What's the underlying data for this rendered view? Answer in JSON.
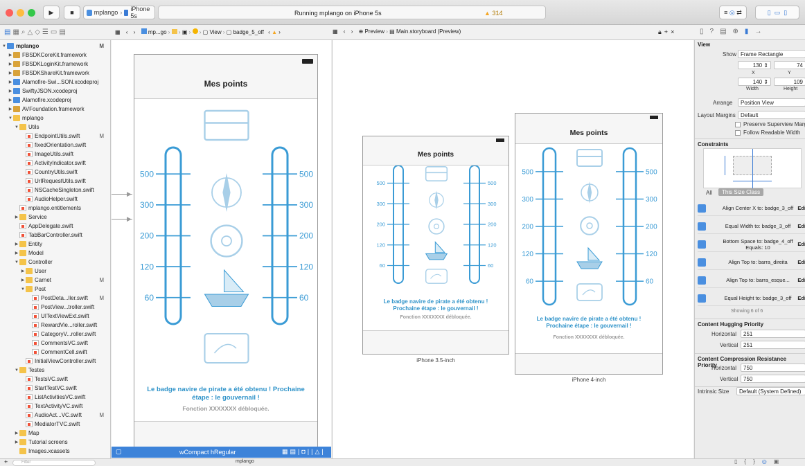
{
  "toolbar": {
    "scheme": "mplango",
    "device": "iPhone 5s",
    "status": "Running mplango on iPhone 5s",
    "warnings": "314"
  },
  "jumpbar": {
    "left_crumbs": [
      "mp...go",
      "View",
      "badge_5_off"
    ],
    "right_crumbs": [
      "Preview",
      "Main.storyboard (Preview)"
    ]
  },
  "navigator": {
    "items": [
      {
        "label": "mplango",
        "icon": "project",
        "level": 0,
        "open": true,
        "badge": "M"
      },
      {
        "label": "FBSDKCoreKit.framework",
        "icon": "framework",
        "level": 1,
        "open": false,
        "badge": ""
      },
      {
        "label": "FBSDKLoginKit.framework",
        "icon": "framework",
        "level": 1,
        "open": false,
        "badge": ""
      },
      {
        "label": "FBSDKShareKit.framework",
        "icon": "framework",
        "level": 1,
        "open": false,
        "badge": ""
      },
      {
        "label": "Alamofire-Swi...SON.xcodeproj",
        "icon": "project",
        "level": 1,
        "open": false,
        "badge": ""
      },
      {
        "label": "SwiftyJSON.xcodeproj",
        "icon": "project",
        "level": 1,
        "open": false,
        "badge": ""
      },
      {
        "label": "Alamofire.xcodeproj",
        "icon": "project",
        "level": 1,
        "open": false,
        "badge": ""
      },
      {
        "label": "AVFoundation.framework",
        "icon": "framework",
        "level": 1,
        "open": false,
        "badge": ""
      },
      {
        "label": "mplango",
        "icon": "folder",
        "level": 1,
        "open": true,
        "badge": ""
      },
      {
        "label": "Utils",
        "icon": "folder",
        "level": 2,
        "open": true,
        "badge": ""
      },
      {
        "label": "EndpointUtils.swift",
        "icon": "swift",
        "level": 3,
        "open": null,
        "badge": "M"
      },
      {
        "label": "fixedOrientation.swift",
        "icon": "swift",
        "level": 3,
        "open": null,
        "badge": ""
      },
      {
        "label": "ImageUtils.swift",
        "icon": "swift",
        "level": 3,
        "open": null,
        "badge": ""
      },
      {
        "label": "ActivityIndicator.swift",
        "icon": "swift",
        "level": 3,
        "open": null,
        "badge": ""
      },
      {
        "label": "CountryUtils.swift",
        "icon": "swift",
        "level": 3,
        "open": null,
        "badge": ""
      },
      {
        "label": "UrlRequestUtils.swift",
        "icon": "swift",
        "level": 3,
        "open": null,
        "badge": ""
      },
      {
        "label": "NSCacheSingleton.swift",
        "icon": "swift",
        "level": 3,
        "open": null,
        "badge": ""
      },
      {
        "label": "AudioHelper.swift",
        "icon": "swift",
        "level": 3,
        "open": null,
        "badge": ""
      },
      {
        "label": "mplango.entitlements",
        "icon": "file",
        "level": 2,
        "open": null,
        "badge": ""
      },
      {
        "label": "Service",
        "icon": "folder",
        "level": 2,
        "open": false,
        "badge": ""
      },
      {
        "label": "AppDelegate.swift",
        "icon": "swift",
        "level": 2,
        "open": null,
        "badge": ""
      },
      {
        "label": "TabBarController.swift",
        "icon": "swift",
        "level": 2,
        "open": null,
        "badge": ""
      },
      {
        "label": "Entity",
        "icon": "folder",
        "level": 2,
        "open": false,
        "badge": ""
      },
      {
        "label": "Model",
        "icon": "folder",
        "level": 2,
        "open": false,
        "badge": ""
      },
      {
        "label": "Controller",
        "icon": "folder",
        "level": 2,
        "open": true,
        "badge": ""
      },
      {
        "label": "User",
        "icon": "folder",
        "level": 3,
        "open": false,
        "badge": ""
      },
      {
        "label": "Carnet",
        "icon": "folder",
        "level": 3,
        "open": false,
        "badge": "M"
      },
      {
        "label": "Post",
        "icon": "folder",
        "level": 3,
        "open": true,
        "badge": ""
      },
      {
        "label": "PostDeta...ller.swift",
        "icon": "swift",
        "level": 4,
        "open": null,
        "badge": "M"
      },
      {
        "label": "PostView...troller.swift",
        "icon": "swift",
        "level": 4,
        "open": null,
        "badge": ""
      },
      {
        "label": "UITextViewExt.swift",
        "icon": "swift",
        "level": 4,
        "open": null,
        "badge": ""
      },
      {
        "label": "RewardVie...roller.swift",
        "icon": "swift",
        "level": 4,
        "open": null,
        "badge": ""
      },
      {
        "label": "CategoryV...roller.swift",
        "icon": "swift",
        "level": 4,
        "open": null,
        "badge": ""
      },
      {
        "label": "CommentsVC.swift",
        "icon": "swift",
        "level": 4,
        "open": null,
        "badge": ""
      },
      {
        "label": "CommentCell.swift",
        "icon": "swift",
        "level": 4,
        "open": null,
        "badge": ""
      },
      {
        "label": "InitialViewController.swift",
        "icon": "swift",
        "level": 3,
        "open": null,
        "badge": ""
      },
      {
        "label": "Testes",
        "icon": "folder",
        "level": 2,
        "open": true,
        "badge": ""
      },
      {
        "label": "TestsVC.swift",
        "icon": "swift",
        "level": 3,
        "open": null,
        "badge": ""
      },
      {
        "label": "StartTestVC.swift",
        "icon": "swift",
        "level": 3,
        "open": null,
        "badge": ""
      },
      {
        "label": "ListActivitiesVC.swift",
        "icon": "swift",
        "level": 3,
        "open": null,
        "badge": ""
      },
      {
        "label": "TextActivityVC.swift",
        "icon": "swift",
        "level": 3,
        "open": null,
        "badge": ""
      },
      {
        "label": "AudioAct...VC.swift",
        "icon": "swift",
        "level": 3,
        "open": null,
        "badge": "M"
      },
      {
        "label": "MediatorTVC.swift",
        "icon": "swift",
        "level": 3,
        "open": null,
        "badge": ""
      },
      {
        "label": "Map",
        "icon": "folder",
        "level": 2,
        "open": false,
        "badge": ""
      },
      {
        "label": "Tutorial screens",
        "icon": "folder",
        "level": 2,
        "open": false,
        "badge": ""
      },
      {
        "label": "Images.xcassets",
        "icon": "folder",
        "level": 2,
        "open": null,
        "badge": ""
      }
    ],
    "filter_placeholder": "Filter"
  },
  "scene": {
    "title": "Mes points",
    "left_scale": [
      "500",
      "300",
      "200",
      "120",
      "60"
    ],
    "right_scale": [
      "500",
      "300",
      "200",
      "120",
      "60"
    ],
    "message": "Le badge navire de pirate a été obtenu ! Prochaine étape : le gouvernail !",
    "unlocked": "Fonction XXXXXXX débloquée."
  },
  "size_class": {
    "label": "wCompact hRegular"
  },
  "previews": {
    "small_caption": "iPhone 3.5-inch",
    "large_caption": "iPhone 4-inch"
  },
  "inspector": {
    "section_view": "View",
    "show_label": "Show",
    "show_value": "Frame Rectangle",
    "x_value": "130",
    "x_label": "X",
    "y_value": "74",
    "y_label": "Y",
    "width_value": "140",
    "width_label": "Width",
    "height_value": "109",
    "height_label": "Height",
    "arrange_label": "Arrange",
    "arrange_value": "Position View",
    "margins_label": "Layout Margins",
    "margins_value": "Default",
    "preserve_label": "Preserve Superview Margi",
    "follow_label": "Follow Readable Width",
    "constraints_title": "Constraints",
    "tab_all": "All",
    "tab_size_class": "This Size Class",
    "constraints": [
      {
        "text": "Align Center X to: badge_3_off",
        "edit": "Edi"
      },
      {
        "text": "Equal Width to: badge_3_off",
        "edit": "Edi"
      },
      {
        "text": "Bottom Space to: badge_4_off",
        "sub": "Equals: 10",
        "edit": "Edi"
      },
      {
        "text": "Align Top to: barra_direita",
        "edit": "Edi"
      },
      {
        "text": "Align Top to: barra_esque...",
        "edit": "Edi"
      },
      {
        "text": "Equal Height to: badge_3_off",
        "edit": "Edi"
      }
    ],
    "showing": "Showing 6 of 6",
    "hugging_title": "Content Hugging Priority",
    "horizontal_label": "Horizontal",
    "vertical_label": "Vertical",
    "hugging_h": "251",
    "hugging_v": "251",
    "compression_title": "Content Compression Resistance Priority",
    "compression_h": "750",
    "compression_v": "750",
    "intrinsic_label": "Intrinsic Size",
    "intrinsic_value": "Default (System Defined)"
  },
  "bottombar": {
    "target": "mplango"
  },
  "colors": {
    "accent": "#2f93c9",
    "gauge": "#3a9bd5",
    "light_icon": "#a8cfe8"
  }
}
